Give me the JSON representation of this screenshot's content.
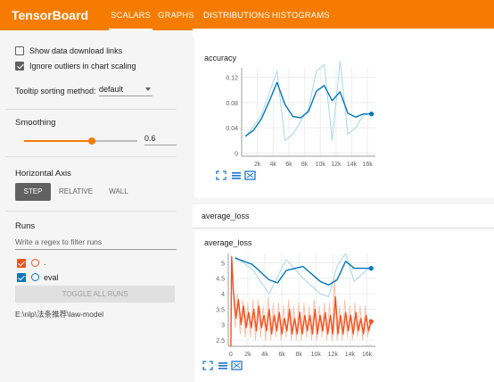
{
  "app": {
    "title": "TensorBoard",
    "tabs": [
      {
        "label": "SCALARS",
        "active": true
      },
      {
        "label": "GRAPHS",
        "active": false
      },
      {
        "label": "DISTRIBUTIONS",
        "active": false
      },
      {
        "label": "HISTOGRAMS",
        "active": false
      }
    ],
    "accent_color": "#f57c00"
  },
  "sidebar": {
    "show_download_label": "Show data download links",
    "show_download_checked": false,
    "ignore_outliers_label": "Ignore outliers in chart scaling",
    "ignore_outliers_checked": true,
    "tooltip_label": "Tooltip sorting method:",
    "tooltip_value": "default",
    "smoothing_title": "Smoothing",
    "smoothing_value": "0.6",
    "smoothing_fraction": 0.6,
    "horizontal_axis_title": "Horizontal Axis",
    "axis_options": [
      "STEP",
      "RELATIVE",
      "WALL"
    ],
    "axis_selected": "STEP",
    "runs_title": "Runs",
    "regex_placeholder": "Write a regex to filter runs",
    "runs": [
      {
        "name": ".",
        "color": "#f4511e",
        "checked": true
      },
      {
        "name": "eval",
        "color": "#0277bd",
        "checked": true
      }
    ],
    "toggle_all_label": "TOGGLE ALL RUNS",
    "logdir": "E:\\nlp\\法条推荐\\law-model"
  },
  "main": {
    "section2_title": "average_loss"
  },
  "chart_data": [
    {
      "type": "line",
      "title": "accuracy",
      "x_tick_labels": [
        "2k",
        "4k",
        "6k",
        "8k",
        "10k",
        "12k",
        "14k",
        "16k"
      ],
      "y_tick_labels": [
        "0",
        "0.04",
        "0.08",
        "0.12"
      ],
      "xlim": [
        0,
        17000
      ],
      "ylim": [
        -0.005,
        0.135
      ],
      "series": [
        {
          "name": "eval",
          "color": "#0277bd",
          "smoothed": true,
          "x": [
            500,
            1500,
            2500,
            3500,
            4500,
            5500,
            6500,
            7500,
            8500,
            9500,
            10500,
            11500,
            12500,
            13500,
            14500,
            15500,
            16500
          ],
          "y": [
            0.027,
            0.036,
            0.054,
            0.082,
            0.112,
            0.077,
            0.058,
            0.056,
            0.066,
            0.098,
            0.107,
            0.083,
            0.097,
            0.063,
            0.057,
            0.062,
            0.062
          ]
        },
        {
          "name": "eval",
          "color": "#a6d8e8",
          "smoothed": false,
          "x": [
            500,
            2500,
            4500,
            5500,
            6500,
            7500,
            8500,
            9500,
            10500,
            11500,
            12500,
            13500,
            14500,
            15500,
            16500
          ],
          "y": [
            0.025,
            0.06,
            0.13,
            0.02,
            0.03,
            0.05,
            0.07,
            0.13,
            0.14,
            0.02,
            0.145,
            0.03,
            0.04,
            0.06,
            0.063
          ]
        }
      ]
    },
    {
      "type": "line",
      "title": "average_loss",
      "x_tick_labels": [
        "0",
        "2k",
        "4k",
        "6k",
        "8k",
        "10k",
        "12k",
        "14k",
        "16k"
      ],
      "y_tick_labels": [
        "2.5",
        "3",
        "3.5",
        "4",
        "4.5",
        "5"
      ],
      "xlim": [
        -300,
        17000
      ],
      "ylim": [
        2.3,
        5.3
      ],
      "series": [
        {
          "name": "eval",
          "color": "#0277bd",
          "smoothed": true,
          "x": [
            500,
            2500,
            4500,
            5500,
            6500,
            8500,
            10500,
            11500,
            12500,
            13500,
            14500,
            16500
          ],
          "y": [
            5.15,
            4.95,
            4.45,
            4.35,
            4.75,
            4.88,
            4.4,
            4.28,
            4.45,
            5.05,
            4.82,
            4.82
          ]
        },
        {
          "name": "eval",
          "color": "#a6d8e8",
          "smoothed": false,
          "x": [
            500,
            2500,
            4500,
            6500,
            8500,
            10500,
            11500,
            12500,
            13500,
            14500,
            16500
          ],
          "y": [
            5.2,
            4.8,
            4.0,
            5.1,
            4.5,
            4.0,
            3.9,
            4.9,
            5.3,
            4.4,
            4.9
          ]
        },
        {
          "name": ".",
          "color": "#f4511e",
          "smoothed": true,
          "x": [
            0,
            100,
            300,
            600,
            900,
            1200,
            1500,
            1800,
            2100,
            2400,
            2700,
            3000,
            3300,
            3600,
            3900,
            4200,
            4500,
            4800,
            5100,
            5400,
            5700,
            6000,
            6300,
            6600,
            6900,
            7200,
            7500,
            7800,
            8100,
            8400,
            8700,
            9000,
            9300,
            9600,
            9900,
            10200,
            10500,
            10800,
            11100,
            11400,
            11700,
            12000,
            12300,
            12600,
            12900,
            13200,
            13500,
            13800,
            14100,
            14400,
            14700,
            15000,
            15300,
            15600,
            15900,
            16200,
            16500
          ],
          "y": [
            2.3,
            5.2,
            4.1,
            3.2,
            3.8,
            3.0,
            3.6,
            2.9,
            3.4,
            2.9,
            3.5,
            2.8,
            3.6,
            2.9,
            3.3,
            2.8,
            3.5,
            2.7,
            3.3,
            2.8,
            3.4,
            2.7,
            3.2,
            2.8,
            3.5,
            2.7,
            3.2,
            2.7,
            3.4,
            2.7,
            3.3,
            2.8,
            3.3,
            2.7,
            3.5,
            2.7,
            3.3,
            2.8,
            3.4,
            2.7,
            3.3,
            2.7,
            3.9,
            2.7,
            3.3,
            2.7,
            3.4,
            2.8,
            3.3,
            2.7,
            3.4,
            2.8,
            3.2,
            2.7,
            3.3,
            2.8,
            3.1
          ]
        },
        {
          "name": ".",
          "color": "#f9c3ae",
          "smoothed": false,
          "x": [
            200,
            500,
            800,
            1100,
            1400,
            1700,
            2000,
            2300,
            2600,
            2900,
            3200,
            3500,
            3800,
            4100,
            4400,
            4700,
            5000,
            5300,
            5600,
            5900,
            6200,
            6500,
            6800,
            7100,
            7400,
            7700,
            8000,
            8300,
            8600,
            8900,
            9200,
            9500,
            9800,
            10100,
            10400,
            10700,
            11000,
            11300,
            11600,
            11900,
            12200,
            12500,
            12800,
            13100,
            13400,
            13700,
            14000,
            14300,
            14600,
            14900,
            15200,
            15500,
            15800,
            16100,
            16400
          ],
          "y": [
            4.4,
            2.9,
            4.0,
            2.7,
            3.8,
            2.6,
            3.7,
            2.6,
            3.8,
            2.5,
            3.8,
            2.6,
            3.6,
            2.5,
            3.9,
            2.5,
            3.7,
            2.6,
            3.7,
            2.5,
            3.6,
            2.6,
            3.8,
            2.5,
            3.6,
            2.5,
            3.7,
            2.5,
            3.7,
            2.6,
            3.6,
            2.5,
            3.8,
            2.5,
            3.6,
            2.6,
            3.7,
            2.5,
            3.7,
            2.5,
            4.5,
            2.5,
            3.6,
            2.5,
            3.8,
            2.6,
            3.6,
            2.5,
            3.7,
            2.6,
            3.6,
            2.5,
            3.6,
            2.6,
            3.2
          ]
        }
      ]
    }
  ]
}
